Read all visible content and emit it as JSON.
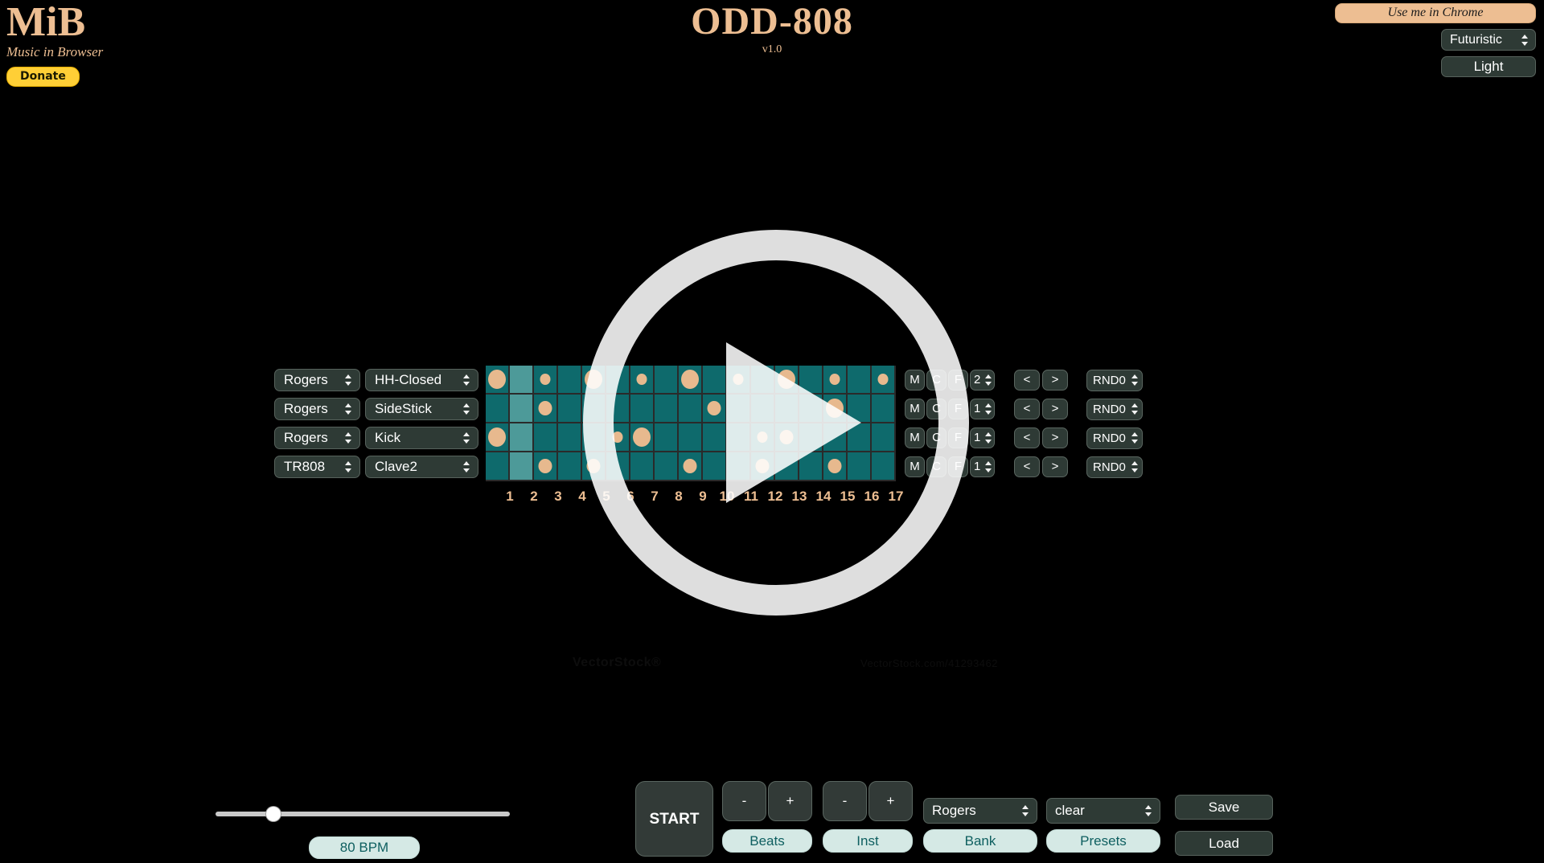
{
  "brand": {
    "title": "MiB",
    "subtitle": "Music in Browser",
    "donate_label": "Donate"
  },
  "header": {
    "app_title": "ODD-808",
    "version": "v1.0",
    "chrome_hint": "Use me in Chrome",
    "theme_value": "Futuristic",
    "light_label": "Light"
  },
  "watermark": {
    "left": "VectorStock®",
    "right": "VectorStock.com/41293462"
  },
  "sequencer": {
    "step_numbers": [
      "1",
      "2",
      "3",
      "4",
      "5",
      "6",
      "7",
      "8",
      "9",
      "10",
      "11",
      "12",
      "13",
      "14",
      "15",
      "16",
      "17"
    ],
    "mute_label": "M",
    "clear_label": "C",
    "fill_label": "F",
    "prev_label": "<",
    "next_label": ">",
    "rows": [
      {
        "bank": "Rogers",
        "instrument": "HH-Closed",
        "repeat": "2",
        "random": "RND0",
        "steps": [
          {
            "on": true,
            "size": "lg"
          },
          {
            "on": false,
            "size": "",
            "playing": true
          },
          {
            "on": true,
            "size": "sm"
          },
          {
            "on": false,
            "size": ""
          },
          {
            "on": true,
            "size": "lg"
          },
          {
            "on": false,
            "size": ""
          },
          {
            "on": true,
            "size": "sm"
          },
          {
            "on": false,
            "size": ""
          },
          {
            "on": true,
            "size": "lg"
          },
          {
            "on": false,
            "size": ""
          },
          {
            "on": true,
            "size": "sm"
          },
          {
            "on": false,
            "size": ""
          },
          {
            "on": true,
            "size": "lg"
          },
          {
            "on": false,
            "size": ""
          },
          {
            "on": true,
            "size": "sm"
          },
          {
            "on": false,
            "size": ""
          },
          {
            "on": true,
            "size": "sm"
          }
        ]
      },
      {
        "bank": "Rogers",
        "instrument": "SideStick",
        "repeat": "1",
        "random": "RND0",
        "steps": [
          {
            "on": false,
            "size": ""
          },
          {
            "on": false,
            "size": "",
            "playing": true
          },
          {
            "on": true,
            "size": "md"
          },
          {
            "on": false,
            "size": ""
          },
          {
            "on": false,
            "size": ""
          },
          {
            "on": false,
            "size": ""
          },
          {
            "on": false,
            "size": ""
          },
          {
            "on": false,
            "size": ""
          },
          {
            "on": false,
            "size": ""
          },
          {
            "on": true,
            "size": "md"
          },
          {
            "on": false,
            "size": ""
          },
          {
            "on": false,
            "size": ""
          },
          {
            "on": false,
            "size": ""
          },
          {
            "on": false,
            "size": ""
          },
          {
            "on": true,
            "size": "lg"
          },
          {
            "on": false,
            "size": ""
          },
          {
            "on": false,
            "size": ""
          }
        ]
      },
      {
        "bank": "Rogers",
        "instrument": "Kick",
        "repeat": "1",
        "random": "RND0",
        "steps": [
          {
            "on": true,
            "size": "lg"
          },
          {
            "on": false,
            "size": "",
            "playing": true
          },
          {
            "on": false,
            "size": ""
          },
          {
            "on": false,
            "size": ""
          },
          {
            "on": false,
            "size": ""
          },
          {
            "on": true,
            "size": "sm"
          },
          {
            "on": true,
            "size": "lg"
          },
          {
            "on": false,
            "size": ""
          },
          {
            "on": false,
            "size": ""
          },
          {
            "on": false,
            "size": ""
          },
          {
            "on": false,
            "size": ""
          },
          {
            "on": true,
            "size": "sm"
          },
          {
            "on": true,
            "size": "md"
          },
          {
            "on": false,
            "size": ""
          },
          {
            "on": false,
            "size": ""
          },
          {
            "on": false,
            "size": ""
          },
          {
            "on": false,
            "size": ""
          }
        ]
      },
      {
        "bank": "TR808",
        "instrument": "Clave2",
        "repeat": "1",
        "random": "RND0",
        "steps": [
          {
            "on": false,
            "size": ""
          },
          {
            "on": false,
            "size": "",
            "playing": true
          },
          {
            "on": true,
            "size": "md"
          },
          {
            "on": false,
            "size": ""
          },
          {
            "on": true,
            "size": "md"
          },
          {
            "on": false,
            "size": ""
          },
          {
            "on": false,
            "size": ""
          },
          {
            "on": false,
            "size": ""
          },
          {
            "on": true,
            "size": "md"
          },
          {
            "on": false,
            "size": ""
          },
          {
            "on": false,
            "size": ""
          },
          {
            "on": true,
            "size": "md"
          },
          {
            "on": false,
            "size": ""
          },
          {
            "on": false,
            "size": ""
          },
          {
            "on": true,
            "size": "md"
          },
          {
            "on": false,
            "size": ""
          },
          {
            "on": false,
            "size": ""
          }
        ]
      }
    ]
  },
  "transport": {
    "bpm_label": "80 BPM",
    "start_label": "START",
    "minus_label": "-",
    "plus_label": "+",
    "beats_label": "Beats",
    "inst_label": "Inst",
    "bank_value": "Rogers",
    "bank_label": "Bank",
    "presets_value": "clear",
    "presets_label": "Presets",
    "save_label": "Save",
    "load_label": "Load"
  },
  "colors": {
    "accent": "#edbe92",
    "cell": "#0e6a6c",
    "cell_playing": "#4d9a99",
    "dot": "#e7b98e",
    "pill": "#d5e9e5",
    "donate": "#ffcf36"
  }
}
